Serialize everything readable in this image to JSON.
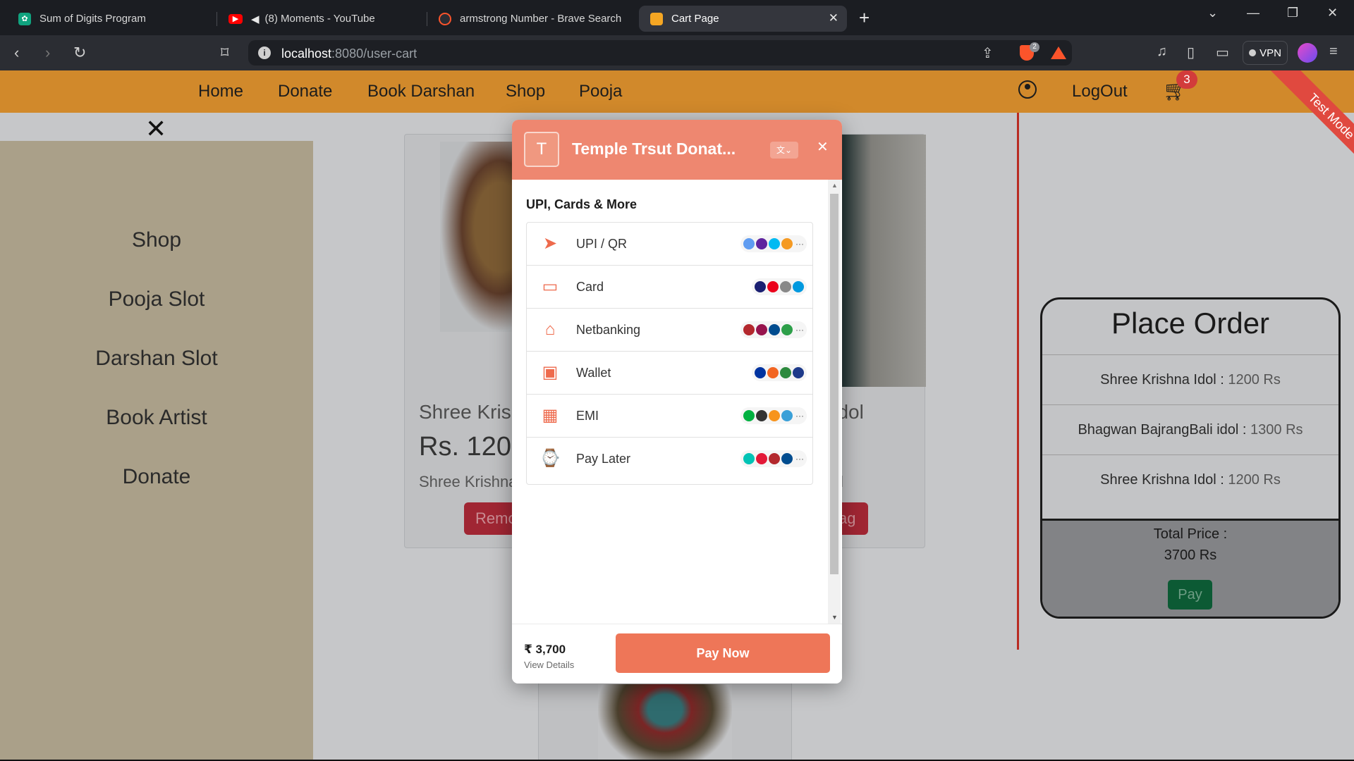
{
  "browser": {
    "tabs": [
      {
        "title": "Sum of Digits Program",
        "icon": "chatgpt-icon",
        "color": "#10a37f"
      },
      {
        "title": "(8) Moments - YouTube",
        "icon": "youtube-icon",
        "color": "#ff0000"
      },
      {
        "title": "armstrong Number - Brave Search",
        "icon": "brave-search-icon",
        "color": "#fb542b"
      },
      {
        "title": "Cart Page",
        "icon": "react-icon",
        "color": "#f5a623"
      }
    ],
    "url_host": "localhost",
    "url_path": ":8080/user-cart",
    "brave_badge": "2",
    "vpn_label": "VPN"
  },
  "site": {
    "nav": [
      "Home",
      "Donate",
      "Book Darshan",
      "Shop",
      "Pooja"
    ],
    "logout": "LogOut",
    "cart_count": "3",
    "test_mode": "Test Mode",
    "accent": "#d1892b"
  },
  "sidebar": {
    "items": [
      "Shop",
      "Pooja Slot",
      "Darshan Slot",
      "Book Artist",
      "Donate"
    ]
  },
  "cards": [
    {
      "title": "Shree Krishr",
      "price": "Rs. 1200",
      "desc": "Shree Krishna I",
      "button": "Remo"
    },
    {
      "title": "li idol",
      "desc": "l",
      "button": "ag"
    }
  ],
  "order": {
    "title": "Place Order",
    "items": [
      {
        "name": "Shree Krishna Idol :",
        "price": "1200 Rs"
      },
      {
        "name": "Bhagwan BajrangBali idol :",
        "price": "1300 Rs"
      },
      {
        "name": "Shree Krishna Idol :",
        "price": "1200 Rs"
      }
    ],
    "total_label": "Total Price :",
    "total_value": "3700 Rs",
    "pay_label": "Pay"
  },
  "payment": {
    "logo_letter": "T",
    "merchant": "Temple Trsut Donat...",
    "section": "UPI, Cards & More",
    "methods": [
      {
        "label": "UPI / QR",
        "icon": "upi-icon"
      },
      {
        "label": "Card",
        "icon": "card-icon"
      },
      {
        "label": "Netbanking",
        "icon": "bank-icon"
      },
      {
        "label": "Wallet",
        "icon": "wallet-icon"
      },
      {
        "label": "EMI",
        "icon": "emi-icon"
      },
      {
        "label": "Pay Later",
        "icon": "paylater-icon"
      }
    ],
    "amount": "₹ 3,700",
    "view_details": "View Details",
    "pay_now": "Pay Now",
    "brand_color": "#ee8770"
  }
}
